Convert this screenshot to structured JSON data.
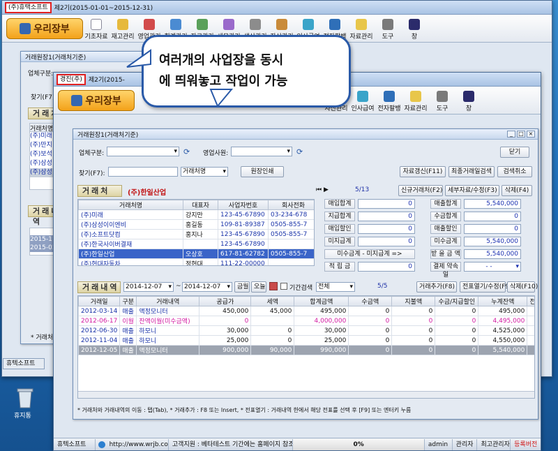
{
  "back_window": {
    "company": "(주)휴택소프트",
    "period": "제2기(2015-01-01~2015-12-31)",
    "toolbar": [
      "기초자료",
      "재고관리",
      "영업관리",
      "회계관리",
      "자금관리",
      "세무관리",
      "생산관리",
      "자산관리",
      "인사급여",
      "전자팔뱅",
      "자료관리",
      "도구",
      "창"
    ],
    "inner_title": "거래원장1(거래처기준)",
    "field_label": "업체구분:",
    "find_label": "찾기(F7):",
    "section": "거래처",
    "section2": "거래내역",
    "list_header": "거래처명",
    "list_items": [
      "(주)미래",
      "(주)만지",
      "(주)보석",
      "(주)삼성",
      "(주)삼성"
    ],
    "dates": [
      "2015-11-",
      "2015-02-"
    ],
    "footnote": "* 거래처와",
    "taskbar": "휴텍소프트"
  },
  "front_window": {
    "company": "경진(주)",
    "period": "제2기(2015-",
    "logo": "우리장부",
    "toolbar": [
      "자산관리",
      "인사급여",
      "전자팔뱅",
      "자료관리",
      "도구",
      "창"
    ]
  },
  "callout": {
    "line1": "여러개의 사업장을 동시",
    "line2": "에 띄워놓고 작업이 가능"
  },
  "ledger": {
    "title": "거래원장1(거래처기준)",
    "business_type_label": "업체구분:",
    "sales_person_label": "영업사원:",
    "close_button": "닫기",
    "find_label": "찾기(F7):",
    "find_dropdown": "거래처명",
    "print_button": "원장인쇄",
    "recalc_button": "자료갱신(F11)",
    "recent_button": "최종거래일검색",
    "cancel_search_button": "검색취소",
    "client_section": "거래처",
    "selected_client": "(주)한일산업",
    "record_pos": "5/13",
    "new_client_button": "신규거래처(F2)",
    "detail_button": "세부자료/수정(F3)",
    "delete_button": "삭제(F4)",
    "client_columns": [
      "거래처명",
      "대표자",
      "사업자번호",
      "회사전화"
    ],
    "clients": [
      [
        "(주)미래",
        "강지만",
        "123-45-67890",
        "03-234-678"
      ],
      [
        "(주)삼성이이엔비",
        "홍길동",
        "109-81-89387",
        "0505-855-7"
      ],
      [
        "(주)소프트닷컴",
        "홍지나",
        "123-45-67890",
        "0505-855-7"
      ],
      [
        "(주)한국사이버결재",
        "",
        "123-45-67890",
        ""
      ],
      [
        "(주)한일산업",
        "오상호",
        "617-81-62782",
        "0505-855-7"
      ],
      [
        "(주)현대자동차",
        "정현대",
        "111-22-00000",
        ""
      ]
    ],
    "summary": {
      "purchase_total_k": "매입합계",
      "purchase_total_v": "0",
      "payment_total_k": "지급합계",
      "payment_total_v": "0",
      "purchase_disc_k": "매입할인",
      "purchase_disc_v": "0",
      "unpaid_total_k": "미지급계",
      "unpaid_total_v": "0",
      "sales_total_k": "매출합계",
      "sales_total_v": "5,540,000",
      "collect_total_k": "수금합계",
      "collect_total_v": "0",
      "sales_disc_k": "매출할인",
      "sales_disc_v": "0",
      "receivable_k": "미수금계",
      "receivable_v": "5,540,000",
      "diff_label": "미수금계 - 미지급계 =>",
      "balance_k": "받 을 금 액",
      "balance_v": "5,540,000",
      "deposit_k": "적 립 금",
      "deposit_v": "0",
      "settle_k": "결제 약속일",
      "settle_v": "- -"
    },
    "tx_section": "거래내역",
    "date_from": "2014-12-07",
    "date_to": "2014-12-07",
    "today_btn1": "금월",
    "today_btn2": "오늘",
    "period_search": "기간검색",
    "period_dropdown": "전체",
    "tx_pos": "5/5",
    "add_tx_button": "거래추가(F8)",
    "open_slip_button": "전표열기/수정(F9)",
    "delete_tx_button": "삭제(F10)",
    "tx_columns": [
      "거래일",
      "구분",
      "거래내역",
      "공급가",
      "세액",
      "합계금액",
      "수금액",
      "지불액",
      "수금/지급할인",
      "누계잔액",
      "전"
    ],
    "transactions": [
      [
        "2012-03-14",
        "매출",
        "액정모니터",
        "450,000",
        "45,000",
        "495,000",
        "0",
        "0",
        "0",
        "495,000"
      ],
      [
        "2012-06-17",
        "이월",
        "잔액이월(미수금액)",
        "0",
        "",
        "4,000,000",
        "0",
        "0",
        "0",
        "4,495,000"
      ],
      [
        "2012-06-30",
        "매출",
        "하모니",
        "30,000",
        "0",
        "30,000",
        "0",
        "0",
        "0",
        "4,525,000"
      ],
      [
        "2012-11-04",
        "매출",
        "하모니",
        "25,000",
        "0",
        "25,000",
        "0",
        "0",
        "0",
        "4,550,000"
      ],
      [
        "2012-12-05",
        "매출",
        "액정모니터",
        "900,000",
        "90,000",
        "990,000",
        "0",
        "0",
        "0",
        "5,540,000"
      ]
    ],
    "footnote": "* 거래처와 거래내역의 이동 : 탭(Tab), * 거래추가 : F8 또는 Insert, * 전표열기 : 거래내역 한에서 해당 전표를 선택 후 [F9] 또는 엔터키 누름"
  },
  "statusbar": {
    "app": "휴텍소프트",
    "url": "http://www.wrjb.co.kr",
    "support": "고객지원 : 베타테스트 기간에는 홈페이지 참조",
    "progress": "0%",
    "user": "admin",
    "role": "관리자",
    "super": "최고관리자",
    "register": "등록버전"
  },
  "desktop": {
    "recycle": "휴지통"
  },
  "colors": {
    "highlight": "#e02020",
    "accent": "#2a5aa8",
    "selected": "#3a64c8"
  }
}
